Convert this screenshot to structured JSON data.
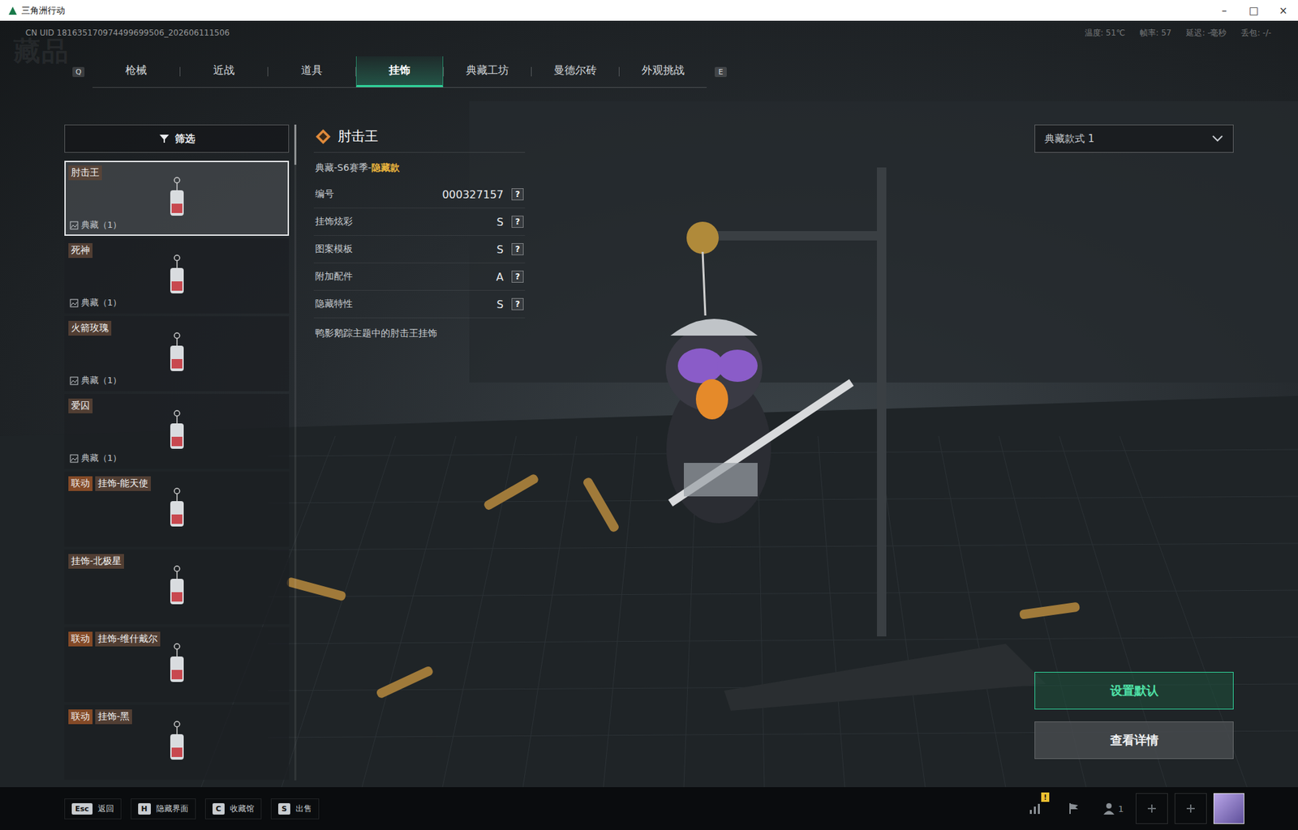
{
  "window": {
    "title": "三角洲行动",
    "controls": [
      "–",
      "□",
      "×"
    ]
  },
  "uid": "CN UID 181635170974499699506_202606111506",
  "stats": [
    "温度: 51℃",
    "帧率: 57",
    "延迟: -毫秒",
    "丢包: -/-"
  ],
  "watermark": "藏品",
  "tabs": {
    "prev_key": "Q",
    "next_key": "E",
    "items": [
      {
        "label": "枪械",
        "selected": false
      },
      {
        "label": "近战",
        "selected": false
      },
      {
        "label": "道具",
        "selected": false
      },
      {
        "label": "挂饰",
        "selected": true
      },
      {
        "label": "典藏工坊",
        "selected": false
      },
      {
        "label": "曼德尔砖",
        "selected": false
      },
      {
        "label": "外观挑战",
        "selected": false
      }
    ]
  },
  "filter": {
    "label": "筛选"
  },
  "items": [
    {
      "name": "肘击王",
      "badge": "",
      "collection": "典藏（1）",
      "selected": true
    },
    {
      "name": "死神",
      "badge": "",
      "collection": "典藏（1）",
      "selected": false
    },
    {
      "name": "火箭玫瑰",
      "badge": "",
      "collection": "典藏（1）",
      "selected": false
    },
    {
      "name": "爱囚",
      "badge": "",
      "collection": "典藏（1）",
      "selected": false
    },
    {
      "name": "挂饰-能天使",
      "badge": "联动",
      "collection": "",
      "selected": false
    },
    {
      "name": "挂饰-北极星",
      "badge": "",
      "collection": "",
      "selected": false
    },
    {
      "name": "挂饰-维什戴尔",
      "badge": "联动",
      "collection": "",
      "selected": false
    },
    {
      "name": "挂饰-黑",
      "badge": "联动",
      "collection": "",
      "selected": false
    }
  ],
  "detail": {
    "title": "肘击王",
    "series": "典藏-S6赛季-",
    "series_tag": "隐藏款",
    "rows": [
      {
        "label": "编号",
        "value": "000327157",
        "help": "?"
      },
      {
        "label": "挂饰炫彩",
        "value": "S",
        "help": "?"
      },
      {
        "label": "图案模板",
        "value": "S",
        "help": "?"
      },
      {
        "label": "附加配件",
        "value": "A",
        "help": "?"
      },
      {
        "label": "隐藏特性",
        "value": "S",
        "help": "?"
      }
    ],
    "description": "鸭影鹅踪主题中的肘击王挂饰"
  },
  "style_select": {
    "value": "典藏款式 1"
  },
  "buttons": [
    {
      "label": "设置默认",
      "kind": "primary"
    },
    {
      "label": "查看详情",
      "kind": "secondary"
    }
  ],
  "shortcuts": [
    {
      "key": "Esc",
      "label": "返回"
    },
    {
      "key": "H",
      "label": "隐藏界面"
    },
    {
      "key": "C",
      "label": "收藏馆"
    },
    {
      "key": "S",
      "label": "出售"
    }
  ],
  "tray": {
    "alert": "!",
    "players": "1"
  }
}
